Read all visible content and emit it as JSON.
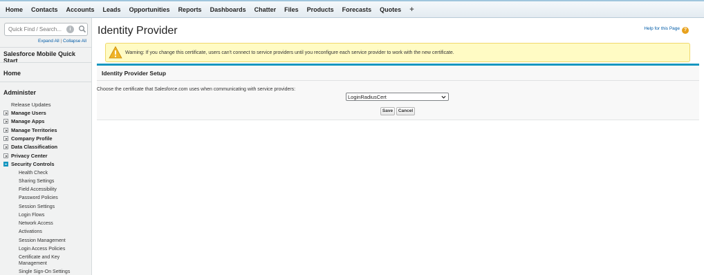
{
  "topnav": {
    "tabs": [
      "Home",
      "Contacts",
      "Accounts",
      "Leads",
      "Opportunities",
      "Reports",
      "Dashboards",
      "Chatter",
      "Files",
      "Products",
      "Forecasts",
      "Quotes"
    ],
    "plus": "+"
  },
  "sidebar": {
    "search_placeholder": "Quick Find / Search...",
    "expand_all": "Expand All",
    "separator": "|",
    "collapse_all": "Collapse All",
    "quick_start": "Salesforce Mobile Quick Start",
    "home": "Home",
    "administer": "Administer",
    "release_updates": "Release Updates",
    "sections": [
      "Manage Users",
      "Manage Apps",
      "Manage Territories",
      "Company Profile",
      "Data Classification",
      "Privacy Center",
      "Security Controls"
    ],
    "security_items": [
      "Health Check",
      "Sharing Settings",
      "Field Accessibility",
      "Password Policies",
      "Session Settings",
      "Login Flows",
      "Network Access",
      "Activations",
      "Session Management",
      "Login Access Policies",
      "Certificate and Key Management",
      "Single Sign-On Settings"
    ]
  },
  "main": {
    "title": "Identity Provider",
    "help_link": "Help for this Page",
    "warning": "Warning: If you change this certificate, users can't connect to service providers until you reconfigure each service provider to work with the new certificate.",
    "panel_title": "Identity Provider Setup",
    "prompt": "Choose the certificate that Salesforce.com uses when communicating with service providers:",
    "selected_cert": "LoginRadiusCert",
    "save_label": "Save",
    "cancel_label": "Cancel"
  },
  "colors": {
    "accent": "#1797c0",
    "link": "#015ba7",
    "warning_bg": "#fffbc4"
  }
}
